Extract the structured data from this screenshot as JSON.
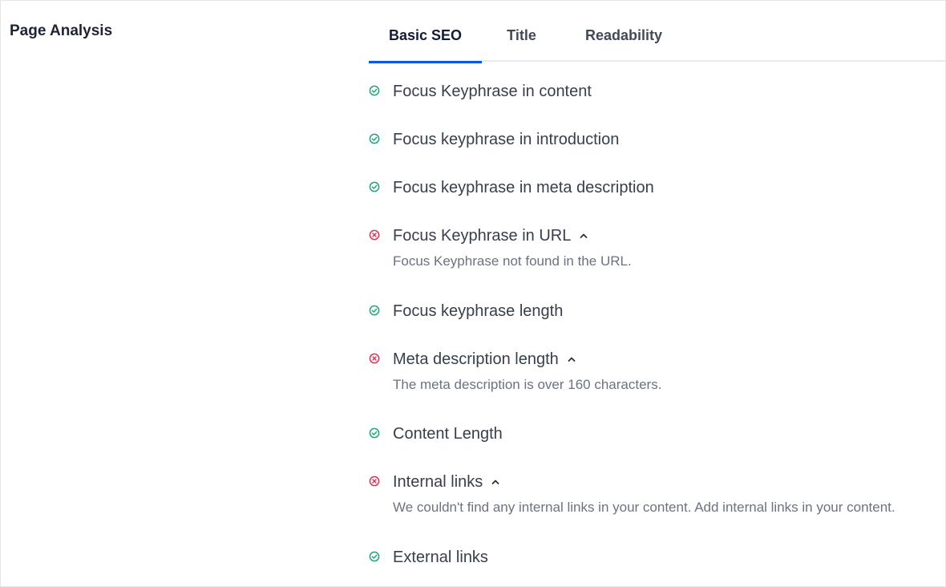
{
  "section": {
    "title": "Page Analysis"
  },
  "tabs": [
    {
      "label": "Basic SEO",
      "active": true
    },
    {
      "label": "Title",
      "active": false
    },
    {
      "label": "Readability",
      "active": false
    }
  ],
  "colors": {
    "pass": "#1fa57c",
    "fail": "#d6365a",
    "accent": "#005ae0"
  },
  "checks": [
    {
      "label": "Focus Keyphrase in content",
      "status": "pass",
      "icon": "check-circle-icon"
    },
    {
      "label": "Focus keyphrase in introduction",
      "status": "pass",
      "icon": "check-circle-icon"
    },
    {
      "label": "Focus keyphrase in meta description",
      "status": "pass",
      "icon": "check-circle-icon"
    },
    {
      "label": "Focus Keyphrase in URL",
      "status": "fail",
      "icon": "x-circle-icon",
      "expanded": true,
      "detail": "Focus Keyphrase not found in the URL."
    },
    {
      "label": "Focus keyphrase length",
      "status": "pass",
      "icon": "check-circle-icon"
    },
    {
      "label": "Meta description length",
      "status": "fail",
      "icon": "x-circle-icon",
      "expanded": true,
      "detail": "The meta description is over 160 characters."
    },
    {
      "label": "Content Length",
      "status": "pass",
      "icon": "check-circle-icon"
    },
    {
      "label": "Internal links",
      "status": "fail",
      "icon": "x-circle-icon",
      "expanded": true,
      "detail": "We couldn't find any internal links in your content. Add internal links in your content."
    },
    {
      "label": "External links",
      "status": "pass",
      "icon": "check-circle-icon"
    }
  ]
}
